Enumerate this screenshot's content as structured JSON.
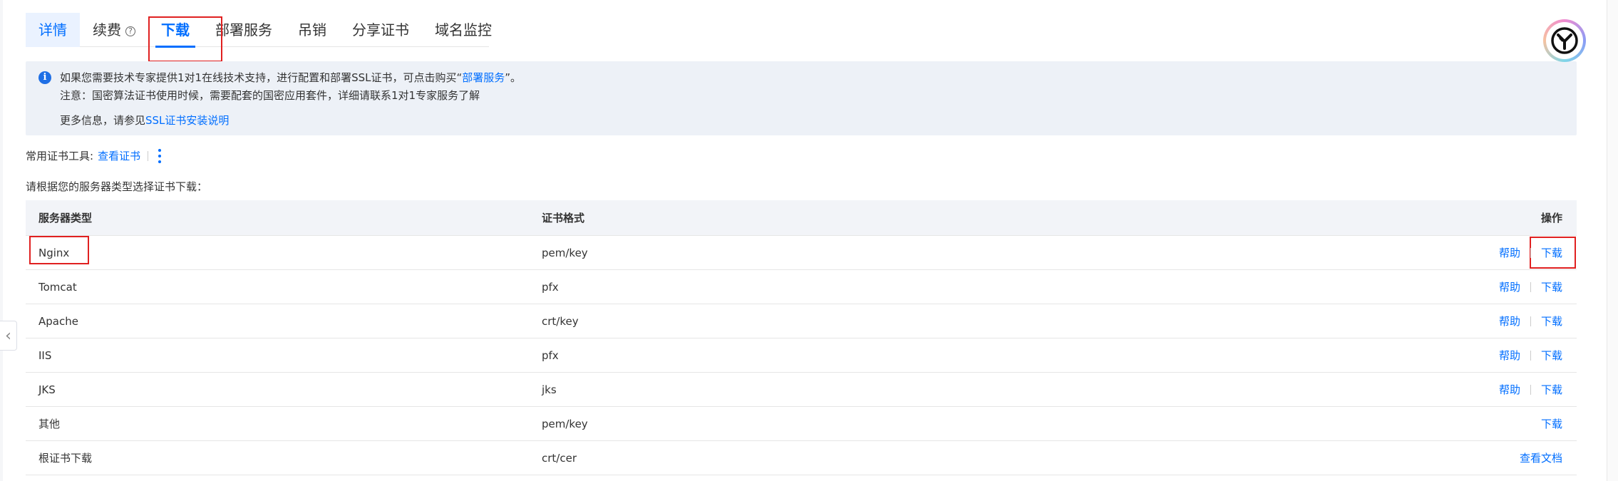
{
  "tabs": [
    {
      "label": "详情"
    },
    {
      "label": "续费"
    },
    {
      "label": "下载"
    },
    {
      "label": "部署服务"
    },
    {
      "label": "吊销"
    },
    {
      "label": "分享证书"
    },
    {
      "label": "域名监控"
    }
  ],
  "banner": {
    "line1_prefix": "如果您需要技术专家提供1对1在线技术支持，进行配置和部署SSL证书，可点击购买“",
    "line1_link": "部署服务",
    "line1_suffix": "”。",
    "line2": "注意：国密算法证书使用时候，需要配套的国密应用套件，详细请联系1对1专家服务了解",
    "line3_prefix": "更多信息，请参见",
    "line3_link": "SSL证书安装说明"
  },
  "tools": {
    "label": "常用证书工具:",
    "view_cert": "查看证书"
  },
  "prompt": "请根据您的服务器类型选择证书下载：",
  "table": {
    "headers": {
      "server_type": "服务器类型",
      "format": "证书格式",
      "actions": "操作"
    },
    "rows": [
      {
        "server": "Nginx",
        "format": "pem/key",
        "help": "帮助",
        "download": "下载"
      },
      {
        "server": "Tomcat",
        "format": "pfx",
        "help": "帮助",
        "download": "下载"
      },
      {
        "server": "Apache",
        "format": "crt/key",
        "help": "帮助",
        "download": "下载"
      },
      {
        "server": "IIS",
        "format": "pfx",
        "help": "帮助",
        "download": "下载"
      },
      {
        "server": "JKS",
        "format": "jks",
        "help": "帮助",
        "download": "下载"
      },
      {
        "server": "其他",
        "format": "pem/key",
        "download": "下载"
      },
      {
        "server": "根证书下载",
        "format": "crt/cer",
        "doc": "查看文档"
      }
    ]
  },
  "icons": {
    "info": "info-icon",
    "help": "question-circle-icon",
    "more": "more-vertical-icon",
    "collapse": "chevron-left-icon",
    "avatar": "brand-logo-icon"
  },
  "colors": {
    "accent": "#006eff",
    "highlight": "#e02020",
    "banner_bg": "#edf1f7"
  }
}
